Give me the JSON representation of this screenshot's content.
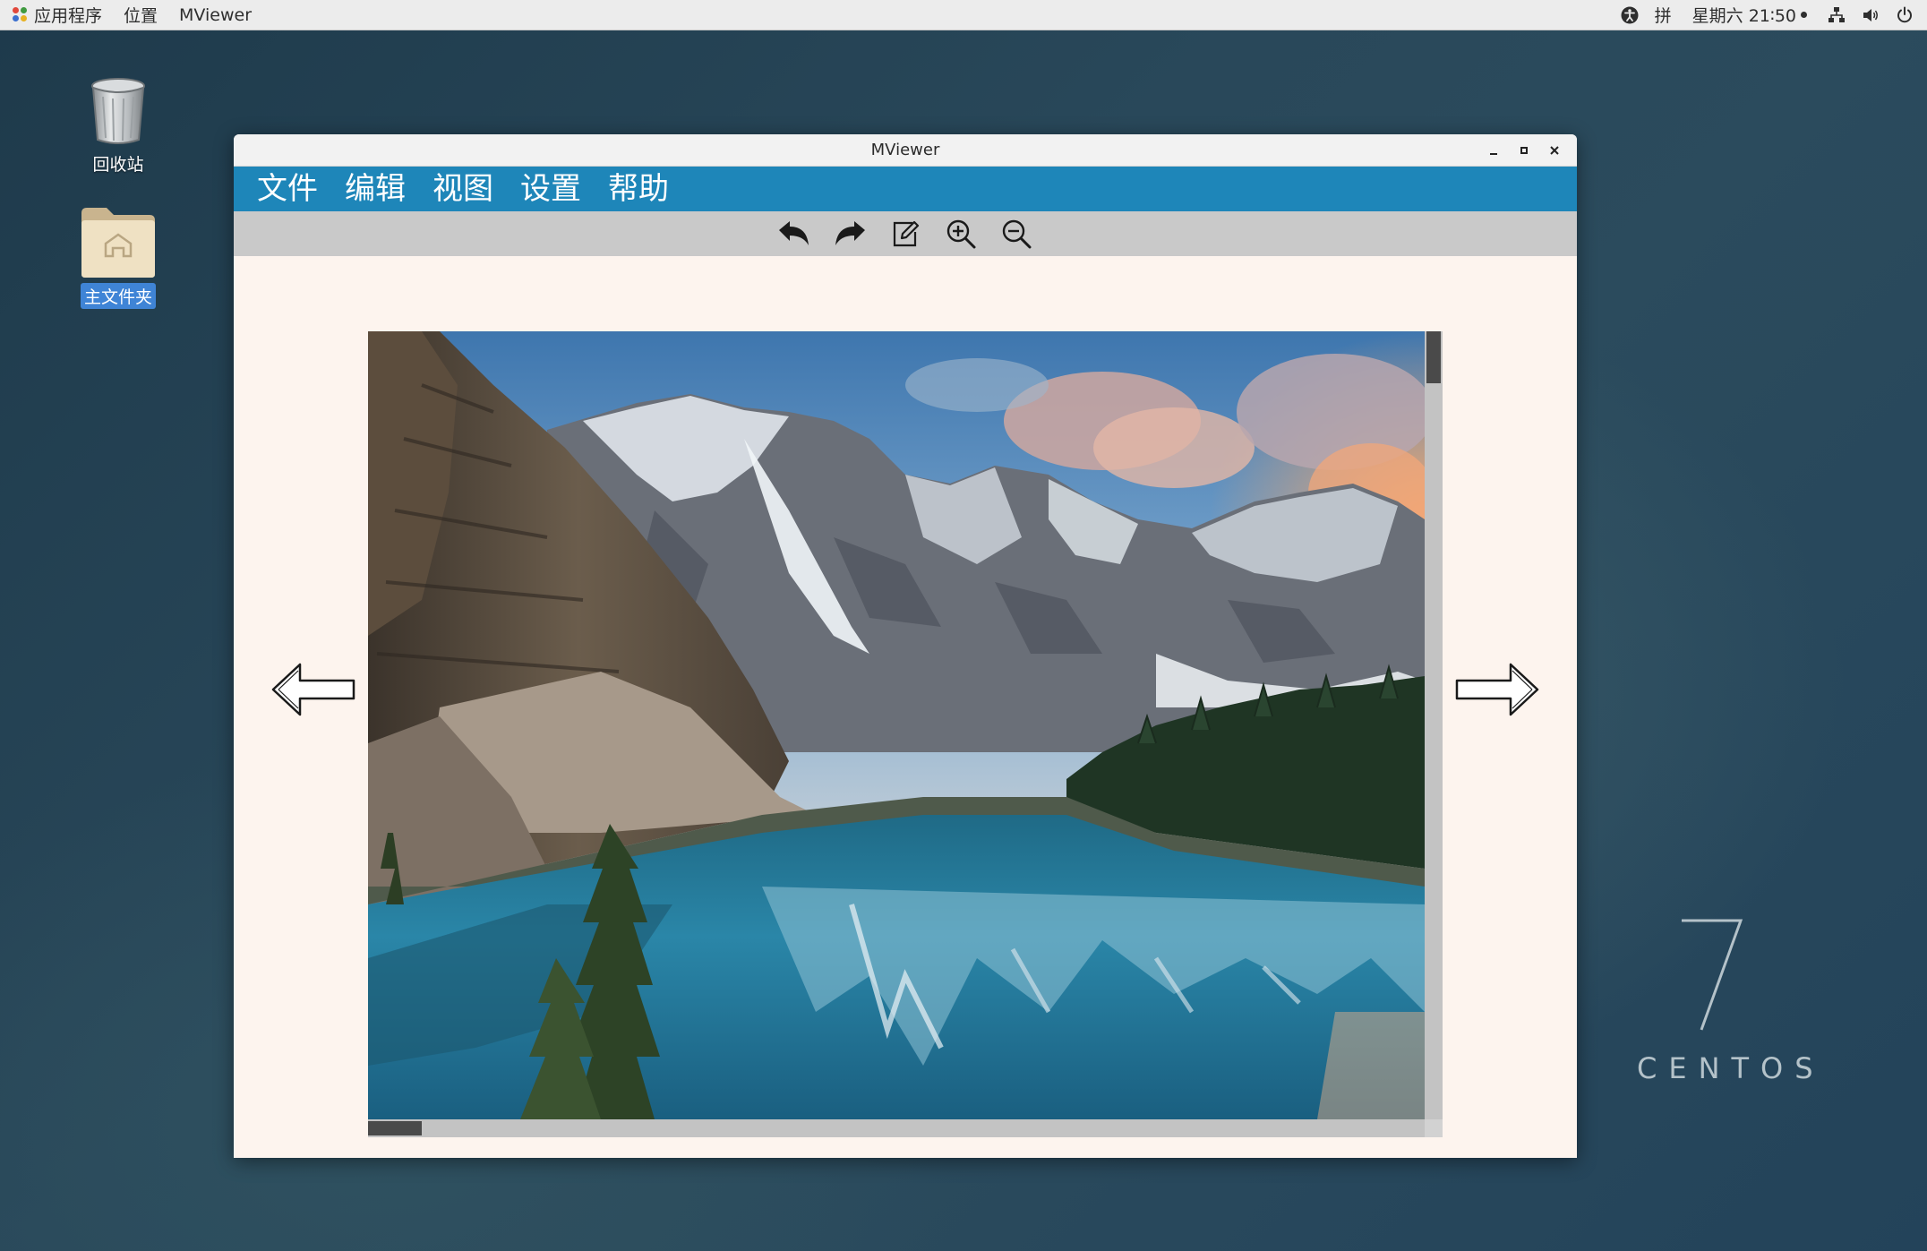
{
  "top_panel": {
    "apps_label": "应用程序",
    "places_label": "位置",
    "active_app_label": "MViewer",
    "input_method": "拼",
    "clock": "星期六 21∶50",
    "icons": [
      "accessibility-icon",
      "network-icon",
      "volume-icon",
      "power-icon"
    ]
  },
  "desktop": {
    "icons": [
      {
        "label": "回收站",
        "icon": "trash-icon",
        "selected": false
      },
      {
        "label": "主文件夹",
        "icon": "home-folder-icon",
        "selected": true
      }
    ],
    "branding": {
      "version": "7",
      "name": "CENTOS"
    }
  },
  "window": {
    "title": "MViewer",
    "controls": [
      "minimize-icon",
      "maximize-icon",
      "close-icon"
    ],
    "menu": [
      "文件",
      "编辑",
      "视图",
      "设置",
      "帮助"
    ],
    "toolbar": [
      "undo-icon",
      "redo-icon",
      "edit-icon",
      "zoom-in-icon",
      "zoom-out-icon"
    ],
    "nav": {
      "prev": "prev-arrow-icon",
      "next": "next-arrow-icon"
    },
    "image": {
      "subject": "mountain-lake-photo"
    }
  },
  "colors": {
    "menubar": "#1e86b9",
    "toolbar": "#c9c9c9",
    "content_bg": "#fdf4ee",
    "selection": "#3f84d6"
  }
}
